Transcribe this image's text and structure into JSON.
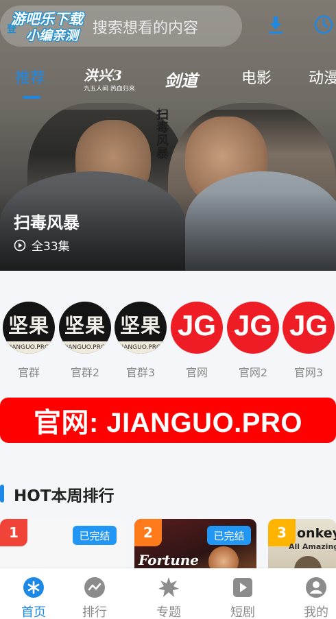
{
  "header": {
    "search_placeholder": "搜索想看的内容",
    "watermark_line1": "游吧乐下载",
    "watermark_line2": "小编亲测",
    "watermark_prefix": "登",
    "download_icon": "download-icon",
    "history_icon": "history-clock-icon"
  },
  "tabs": [
    {
      "label": "推荐",
      "active": true
    },
    {
      "label": "洪兴3",
      "sub": "九五人间 热血归来",
      "logo": true
    },
    {
      "label": "剑道",
      "logo": true
    },
    {
      "label": "电影"
    },
    {
      "label": "动漫"
    }
  ],
  "featured": {
    "poster_vertical_title": "扫毒风暴",
    "title": "扫毒风暴",
    "episodes": "全33集"
  },
  "avatars": [
    {
      "big": "坚果",
      "small": "JIANGUO.PRO",
      "label": "官群",
      "style": "black"
    },
    {
      "big": "坚果",
      "small": "JIANGUO.PRO",
      "label": "官群2",
      "style": "black"
    },
    {
      "big": "坚果",
      "small": "JIANGUO.PRO",
      "label": "官群3",
      "style": "black"
    },
    {
      "big": "JG",
      "label": "官网",
      "style": "red"
    },
    {
      "big": "JG",
      "label": "官网2",
      "style": "red"
    },
    {
      "big": "JG",
      "label": "官网3",
      "style": "red"
    }
  ],
  "banner": {
    "text": "官网: JIANGUO.PRO"
  },
  "section": {
    "title": "HOT本周排行"
  },
  "ranking": [
    {
      "rank": "1",
      "status": "已完结",
      "rank_color": "#f04438"
    },
    {
      "rank": "2",
      "status": "已完结",
      "rank_color": "#ff7a1a",
      "poster_text": "Fortune"
    },
    {
      "rank": "3",
      "rank_color": "#ffb400",
      "poster_text": "onkeys",
      "poster_sub": "All Amazing A"
    }
  ],
  "bottom_nav": [
    {
      "label": "首页",
      "icon": "home-star-icon",
      "active": true
    },
    {
      "label": "排行",
      "icon": "ranking-wave-icon"
    },
    {
      "label": "专题",
      "icon": "topic-burst-icon"
    },
    {
      "label": "短剧",
      "icon": "short-play-icon"
    },
    {
      "label": "我的",
      "icon": "profile-icon"
    }
  ],
  "colors": {
    "accent": "#1e88e5",
    "banner_red": "#fe0000",
    "badge_blue": "#2196f3"
  }
}
